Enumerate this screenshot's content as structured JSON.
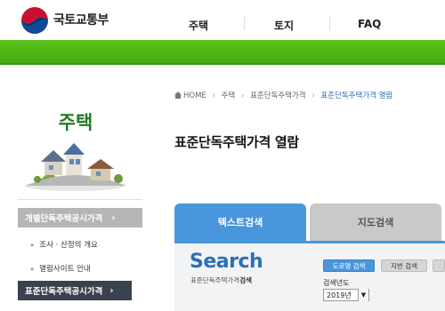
{
  "header": {
    "logo_text": "국토교통부",
    "nav": [
      "주택",
      "토지",
      "FAQ"
    ]
  },
  "sidebar": {
    "title": "주택",
    "menu1": "개별단독주택공시가격",
    "sub_items": [
      "조사 · 산정의 개요",
      "열람사이트 안내"
    ],
    "menu2": "표준단독주택공시가격"
  },
  "breadcrumb": {
    "home": "HOME",
    "items": [
      "주택",
      "표준단독주택가격"
    ],
    "current": "표준단독주택가격 열람"
  },
  "page_title": "표준단독주택가격 열람",
  "tabs": {
    "text_search": "텍스트검색",
    "map_search": "지도검색"
  },
  "search": {
    "heading": "Search",
    "sub_prefix": "표준단독주택가격",
    "sub_bold": "검색",
    "road_button": "도로명 검색",
    "lot_button": "지번 검색",
    "year_label": "검색년도",
    "year_value": "2019년"
  },
  "colors": {
    "green": "#4fb818",
    "accent_blue": "#4a96dc",
    "sidebar_active": "#3a4250",
    "title_green": "#1f7a23"
  }
}
